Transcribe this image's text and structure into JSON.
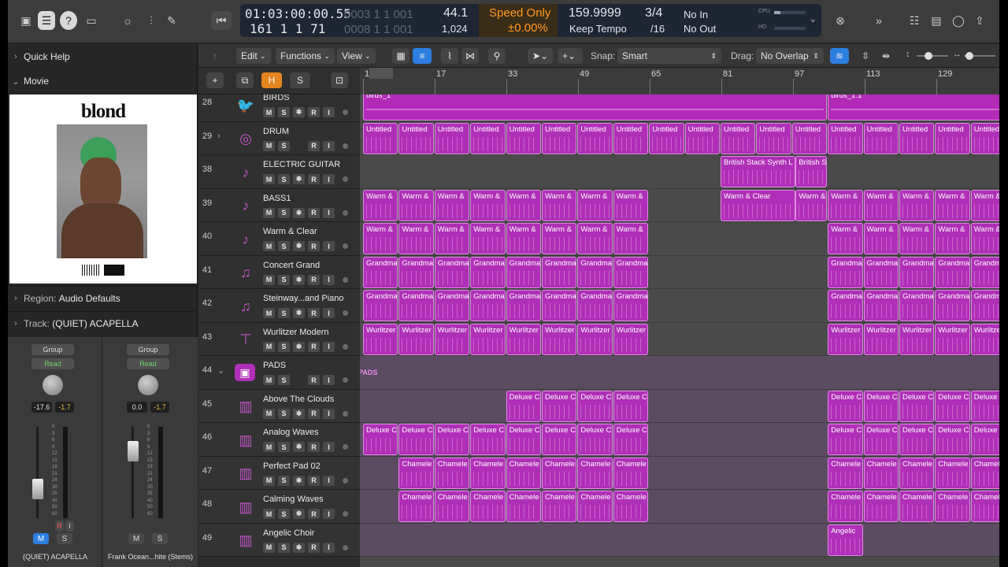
{
  "lcd": {
    "position": "01:03:00:00.55",
    "bars": "161  1  1    71",
    "bars_dim_top": "0003  1  1  001",
    "bars_dim_bottom": "0008  1  1  001",
    "sample_rate": "44.1",
    "buffer": "1,024",
    "speed_mode": "Speed Only",
    "speed_pct": "±0.00%",
    "tempo": "159.9999",
    "tempo_mode": "Keep Tempo",
    "sig_top": "3/4",
    "sig_bottom": "/16",
    "in": "No In",
    "out": "No Out",
    "cpu_label": "CPU",
    "hd_label": "HD"
  },
  "inspector": {
    "quick_help": "Quick Help",
    "movie": "Movie",
    "album_title": "blond",
    "region_label": "Region:",
    "region_value": "Audio Defaults",
    "track_label": "Track:",
    "track_value": "(QUIET) ACAPELLA"
  },
  "mixer": [
    {
      "group": "Group",
      "auto": "Read",
      "pan_val": "-17.6",
      "peak": "-1.7",
      "name": "(QUIET) ACAPELLA",
      "m": "M",
      "s": "S",
      "r": "R",
      "i": "I"
    },
    {
      "group": "Group",
      "auto": "Read",
      "pan_val": "0.0",
      "peak": "-1.7",
      "name": "Frank Ocean...hite (Stems)",
      "m": "M",
      "s": "S"
    }
  ],
  "meter_scale": [
    "0",
    "3",
    "6",
    "9",
    "12",
    "15",
    "18",
    "21",
    "24",
    "30",
    "35",
    "40",
    "50",
    "60"
  ],
  "toolbar": {
    "edit": "Edit",
    "functions": "Functions",
    "view": "View",
    "snap_label": "Snap:",
    "snap_value": "Smart",
    "drag_label": "Drag:",
    "drag_value": "No Overlap"
  },
  "ruler": [
    "1",
    "17",
    "33",
    "49",
    "65",
    "81",
    "97",
    "113",
    "129"
  ],
  "tracks": [
    {
      "num": "28",
      "name": "BIRDS",
      "icon": "bird-icon"
    },
    {
      "num": "29",
      "name": "DRUM",
      "icon": "drum-icon"
    },
    {
      "num": "38",
      "name": "ELECTRIC GUITAR",
      "icon": "guitar-icon"
    },
    {
      "num": "39",
      "name": "BASS1",
      "icon": "guitar-icon"
    },
    {
      "num": "40",
      "name": "Warm & Clear",
      "icon": "guitar-icon"
    },
    {
      "num": "41",
      "name": "Concert Grand",
      "icon": "piano-icon"
    },
    {
      "num": "42",
      "name": "Steinway...and Piano",
      "icon": "piano-icon"
    },
    {
      "num": "43",
      "name": "Wurlitzer Modern",
      "icon": "keys-icon"
    },
    {
      "num": "44",
      "name": "PADS",
      "icon": "folder-icon"
    },
    {
      "num": "45",
      "name": "Above The Clouds",
      "icon": "synth-icon"
    },
    {
      "num": "46",
      "name": "Analog Waves",
      "icon": "synth-icon"
    },
    {
      "num": "47",
      "name": "Perfect Pad 02",
      "icon": "synth-icon"
    },
    {
      "num": "48",
      "name": "Calming Waves",
      "icon": "synth-icon"
    },
    {
      "num": "49",
      "name": "Angelic Choir",
      "icon": "synth-icon"
    }
  ],
  "btn": {
    "m": "M",
    "s": "S",
    "f": "❄",
    "r": "R",
    "i": "I"
  },
  "region_labels": {
    "birds_a": "birds_1",
    "birds_b": "birds_1.1",
    "drum": "Untitled",
    "eg_a": "British Stack Synth L",
    "eg_b": "British St",
    "warm": "Warm &",
    "warm_clear": "Warm & Clear",
    "grand": "Grandma",
    "wurl": "Wurlitzer",
    "pads_folder": "PADS",
    "deluxe": "Deluxe C",
    "chamele": "Chamele",
    "angelic": "Angelic"
  },
  "colors": {
    "region": "#b02fb8",
    "region_border": "#e38de8",
    "accent_blue": "#2c7fe0",
    "lcd_bg": "#1e2533",
    "speed_orange": "#ff9a1f"
  }
}
